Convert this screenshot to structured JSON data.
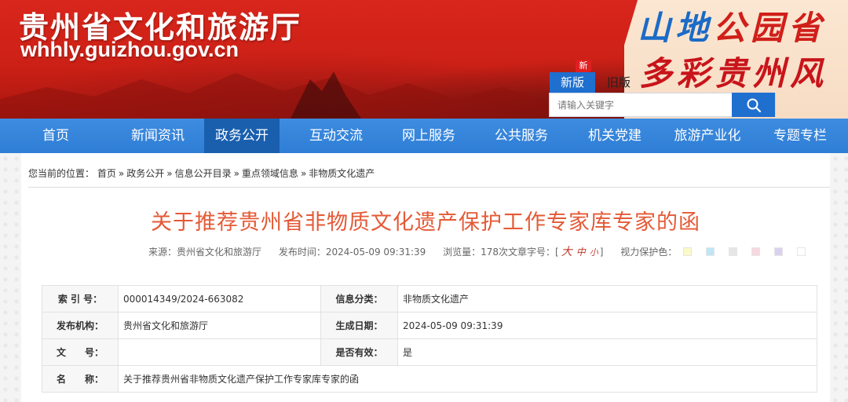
{
  "header": {
    "site_title": "贵州省文化和旅游厅",
    "site_domain": "whhly.guizhou.gov.cn",
    "slogan_line1_part1": "山地",
    "slogan_line1_part2": "公园省",
    "slogan_line2": "多彩贵州风",
    "version_new": "新版",
    "version_new_badge": "新",
    "version_old": "旧版",
    "search_placeholder": "请输入关键字"
  },
  "nav": {
    "items": [
      {
        "label": "首页"
      },
      {
        "label": "新闻资讯"
      },
      {
        "label": "政务公开"
      },
      {
        "label": "互动交流"
      },
      {
        "label": "网上服务"
      },
      {
        "label": "公共服务"
      },
      {
        "label": "机关党建"
      },
      {
        "label": "旅游产业化"
      },
      {
        "label": "专题专栏"
      }
    ],
    "active_index": 2
  },
  "breadcrumb": {
    "prefix": "您当前的位置：",
    "items": [
      "首页",
      "政务公开",
      "信息公开目录",
      "重点领域信息",
      "非物质文化遗产"
    ],
    "separator": "»"
  },
  "article": {
    "title": "关于推荐贵州省非物质文化遗产保护工作专家库专家的函",
    "source": "来源：贵州省文化和旅游厅",
    "publish_time": "发布时间：2024-05-09 09:31:39",
    "views": "浏览量：178次",
    "font_size_label": "文章字号：[",
    "font_large": "大",
    "font_medium": "中",
    "font_small": "小",
    "font_close": "]",
    "eye_care_label": "视力保护色：",
    "eye_care_colors": [
      "#fafac8",
      "#bfe6f5",
      "#e6e6e6",
      "#f7d7e0",
      "#dcd0f0",
      "#ffffff"
    ]
  },
  "info_table": {
    "index_label": "索 引 号：",
    "index_value": "000014349/2024-663082",
    "category_label": "信息分类：",
    "category_value": "非物质文化遗产",
    "publisher_label": "发布机构：",
    "publisher_value": "贵州省文化和旅游厅",
    "created_label": "生成日期：",
    "created_value": "2024-05-09 09:31:39",
    "doc_no_label": "文　　号：",
    "doc_no_value": "",
    "valid_label": "是否有效：",
    "valid_value": "是",
    "name_label": "名　　称：",
    "name_value": "关于推荐贵州省非物质文化遗产保护工作专家库专家的函"
  },
  "colors": {
    "header_red": "#d9261c",
    "nav_blue": "#3d8ce0",
    "nav_active": "#1a5fae",
    "title_orange": "#e45a36",
    "search_button": "#1f6fcf"
  }
}
